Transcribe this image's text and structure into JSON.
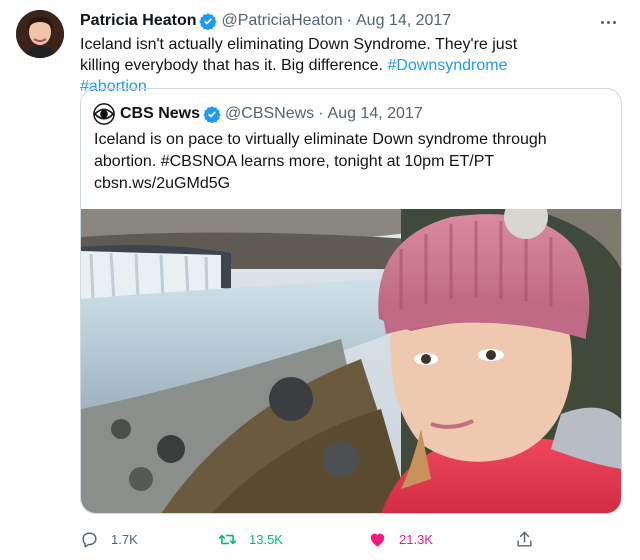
{
  "author": {
    "display_name": "Patricia Heaton",
    "handle": "@PatriciaHeaton",
    "date": "Aug 14, 2017"
  },
  "tweet": {
    "text_plain": "Iceland isn't actually eliminating Down Syndrome. They're just killing everybody that has it. Big difference.",
    "hashtags": [
      "#Downsyndrome",
      "#abortion"
    ]
  },
  "quoted": {
    "display_name": "CBS News",
    "handle": "@CBSNews",
    "date": "Aug 14, 2017",
    "text": "Iceland is on pace to virtually eliminate Down syndrome through abortion. #CBSNOA learns more, tonight at 10pm ET/PT",
    "link": "cbsn.ws/2uGMd5G"
  },
  "actions": {
    "replies": "1.7K",
    "retweets": "13.5K",
    "likes": "21.3K"
  },
  "colors": {
    "accent": "#1d9bf0",
    "retweet": "#00ba7c",
    "like": "#f91880",
    "muted": "#536471"
  },
  "icons": {
    "verified": "verified-badge-icon",
    "more": "more-dots-icon",
    "reply": "reply-icon",
    "retweet": "retweet-icon",
    "like": "heart-icon",
    "share": "share-icon",
    "cbs_logo": "cbs-eye-logo-icon"
  }
}
